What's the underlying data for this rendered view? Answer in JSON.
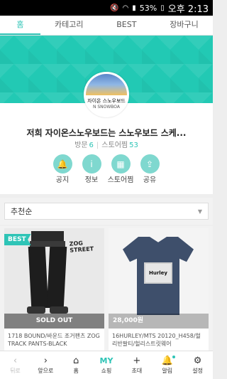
{
  "status_bar": {
    "battery": "53%",
    "time": "오후 2:13"
  },
  "tabs": [
    {
      "label": "홈",
      "active": true
    },
    {
      "label": "카테고리",
      "active": false
    },
    {
      "label": "BEST",
      "active": false
    },
    {
      "label": "장바구니",
      "active": false
    }
  ],
  "colors": {
    "accent": "#2ec4b6",
    "banner": "#22c9b4"
  },
  "store": {
    "logo_name": "자이온 스노우보드",
    "logo_sub": "N SNOWBOA",
    "title": "저희 자이온스노우보드는 스노우보드 스케...",
    "visits_label": "방문",
    "visits": "6",
    "storm_label": "스토어찜",
    "storm": "53"
  },
  "actions": [
    {
      "label": "공지",
      "icon": "bell-icon",
      "glyph": "🔔"
    },
    {
      "label": "정보",
      "icon": "info-icon",
      "glyph": "i"
    },
    {
      "label": "스토어찜",
      "icon": "store-favorite-icon",
      "glyph": "▦"
    },
    {
      "label": "공유",
      "icon": "share-icon",
      "glyph": "⇪"
    }
  ],
  "sort": {
    "selected": "추천순"
  },
  "products": [
    {
      "badge": "BEST",
      "overlay": "SOLD OUT",
      "brand_text": "ZOG STREET",
      "title": "1718 BOUND/바운드 조거팬츠 ZOG TRACK PANTS-BLACK"
    },
    {
      "overlay": "28,000원",
      "brand_text": "Hurley",
      "title": "16HURLEY/MTS 20120_H458/헐리반팔티/헐리스트릿웨어"
    }
  ],
  "bottom_nav": [
    {
      "label": "뒤로",
      "glyph": "‹",
      "icon": "back-icon",
      "disabled": true
    },
    {
      "label": "앞으로",
      "glyph": "›",
      "icon": "forward-icon",
      "disabled": false
    },
    {
      "label": "홈",
      "glyph": "⌂",
      "icon": "home-icon",
      "disabled": false
    },
    {
      "label": "쇼핑",
      "glyph": "MY",
      "icon": "my-shopping-icon",
      "disabled": false
    },
    {
      "label": "초대",
      "glyph": "+",
      "icon": "invite-icon",
      "disabled": false
    },
    {
      "label": "알림",
      "glyph": "🔔",
      "icon": "notification-icon",
      "disabled": false
    },
    {
      "label": "설정",
      "glyph": "⚙",
      "icon": "gear-icon",
      "disabled": false
    }
  ]
}
